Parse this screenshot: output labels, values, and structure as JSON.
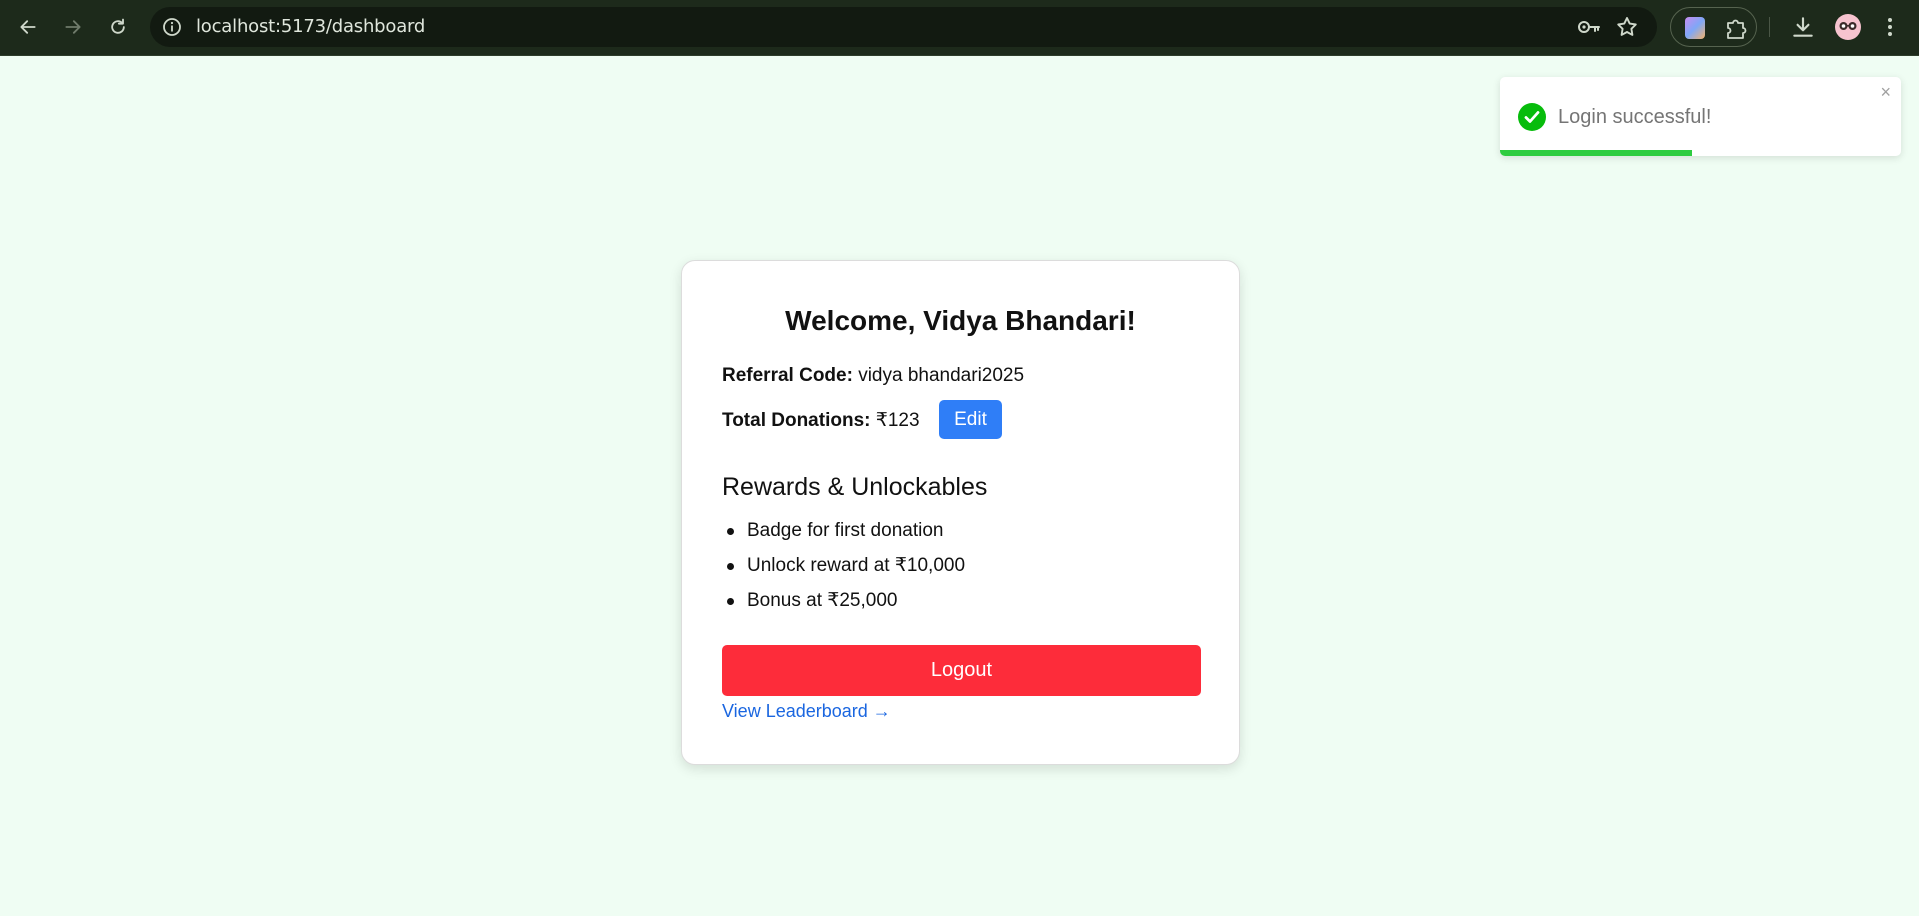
{
  "browser": {
    "url": "localhost:5173/dashboard"
  },
  "toast": {
    "message": "Login successful!",
    "close": "×",
    "progress": 0.48,
    "color": "#2ecc40"
  },
  "dashboard": {
    "title": "Welcome, Vidya Bhandari!",
    "referral_label": "Referral Code:",
    "referral_value": "vidya bhandari2025",
    "donations_label": "Total Donations:",
    "donations_value": "₹123",
    "edit_label": "Edit",
    "rewards_heading": "Rewards & Unlockables",
    "rewards": [
      "Badge for first donation",
      "Unlock reward at ₹10,000",
      "Bonus at ₹25,000"
    ],
    "logout_label": "Logout",
    "leaderboard_link": "View Leaderboard →"
  },
  "colors": {
    "page_bg": "#effdf3",
    "edit_button": "#2f7ef7",
    "logout_button": "#fd2c3a",
    "link": "#1a66e0"
  }
}
